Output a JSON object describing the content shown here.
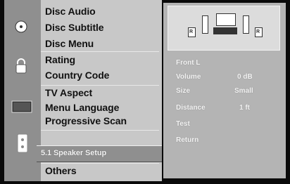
{
  "left_menu": {
    "groups": [
      {
        "icon": "disc-icon",
        "items": [
          "Disc Audio",
          "Disc Subtitle",
          "Disc Menu"
        ]
      },
      {
        "icon": "lock-icon",
        "items": [
          "Rating",
          "Country Code"
        ]
      },
      {
        "icon": "tv-icon",
        "items": [
          "TV Aspect",
          "Menu Language",
          "Progressive Scan"
        ]
      },
      {
        "icon": "speaker-icon",
        "items": [
          "5.1 Speaker Setup"
        ]
      },
      {
        "icon": "",
        "items": [
          "Others"
        ]
      }
    ],
    "selected": "5.1 Speaker Setup"
  },
  "speaker_setup": {
    "diagram": {
      "left_label": "R",
      "right_label": "R"
    },
    "fields": [
      {
        "label": "Front L",
        "value": ""
      },
      {
        "label": "Volume",
        "value": "0 dB"
      },
      {
        "label": "Size",
        "value": "Small"
      },
      {
        "label": "Distance",
        "value": "1 ft"
      },
      {
        "label": "Test",
        "value": ""
      },
      {
        "label": "Return",
        "value": ""
      }
    ]
  },
  "colors": {
    "menu_bg": "#c8c8c8",
    "icon_col": "#8f8f8f",
    "right_bg": "#b4b4b4",
    "text_dark": "#111111",
    "text_light": "#f4f4f4"
  }
}
